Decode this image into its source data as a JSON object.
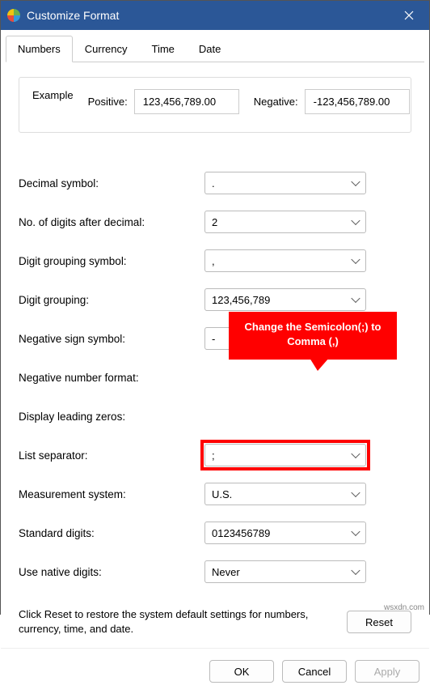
{
  "window": {
    "title": "Customize Format"
  },
  "tabs": {
    "numbers": "Numbers",
    "currency": "Currency",
    "time": "Time",
    "date": "Date"
  },
  "example": {
    "legend": "Example",
    "positive_label": "Positive:",
    "positive_value": "123,456,789.00",
    "negative_label": "Negative:",
    "negative_value": "-123,456,789.00"
  },
  "fields": {
    "decimal_symbol": {
      "label": "Decimal symbol:",
      "value": "."
    },
    "digits_after_decimal": {
      "label": "No. of digits after decimal:",
      "value": "2"
    },
    "digit_grouping_symbol": {
      "label": "Digit grouping symbol:",
      "value": ","
    },
    "digit_grouping": {
      "label": "Digit grouping:",
      "value": "123,456,789"
    },
    "negative_sign_symbol": {
      "label": "Negative sign symbol:",
      "value": "-"
    },
    "negative_number_format": {
      "label": "Negative number format:",
      "value": ""
    },
    "display_leading_zeros": {
      "label": "Display leading zeros:",
      "value": ""
    },
    "list_separator": {
      "label": "List separator:",
      "value": ";"
    },
    "measurement_system": {
      "label": "Measurement system:",
      "value": "U.S."
    },
    "standard_digits": {
      "label": "Standard digits:",
      "value": "0123456789"
    },
    "use_native_digits": {
      "label": "Use native digits:",
      "value": "Never"
    }
  },
  "tooltip": {
    "line1": "Change the Semicolon(;) to",
    "line2": "Comma (,)"
  },
  "reset": {
    "text": "Click Reset to restore the system default settings for numbers, currency, time, and date.",
    "button": "Reset"
  },
  "footer": {
    "ok": "OK",
    "cancel": "Cancel",
    "apply": "Apply"
  },
  "watermark": "wsxdn.com"
}
